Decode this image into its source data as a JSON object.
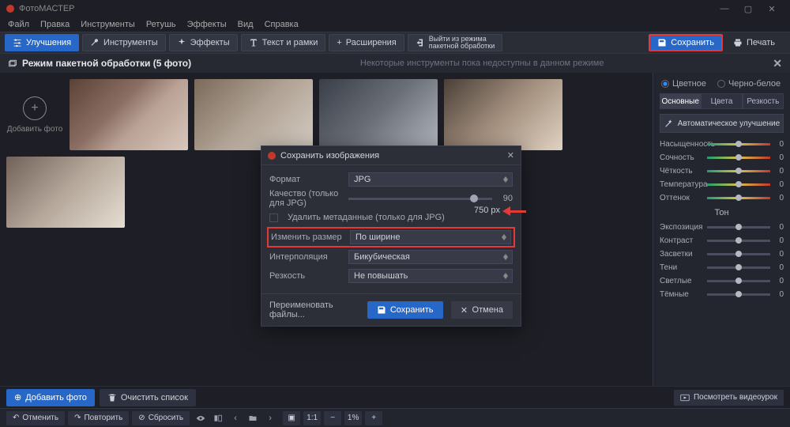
{
  "titlebar": {
    "app_name": "ФотоМАСТЕР"
  },
  "menubar": [
    "Файл",
    "Правка",
    "Инструменты",
    "Ретушь",
    "Эффекты",
    "Вид",
    "Справка"
  ],
  "toolbar": {
    "enhance": "Улучшения",
    "tools": "Инструменты",
    "effects": "Эффекты",
    "text": "Текст и рамки",
    "extensions": "Расширения",
    "exit_batch_l1": "Выйти из режима",
    "exit_batch_l2": "пакетной обработки",
    "save": "Сохранить",
    "print": "Печать"
  },
  "batch_header": {
    "title": "Режим пакетной обработки (5 фото)",
    "note": "Некоторые инструменты пока недоступны в данном режиме"
  },
  "stage": {
    "add_photo": "Добавить фото",
    "add_photo_btn": "Добавить фото",
    "clear_list": "Очистить список",
    "video_tutorial": "Посмотреть видеоурок"
  },
  "dialog": {
    "title": "Сохранить изображения",
    "format": {
      "label": "Формат",
      "value": "JPG"
    },
    "quality": {
      "label": "Качество (только для JPG)",
      "value": "90"
    },
    "meta": {
      "label": "Удалить метаданные (только для JPG)"
    },
    "resize": {
      "label": "Изменить размер",
      "value": "По ширине",
      "px_value": "750",
      "px_suffix": "px"
    },
    "interp": {
      "label": "Интерполяция",
      "value": "Бикубическая"
    },
    "sharp": {
      "label": "Резкость",
      "value": "Не повышать"
    },
    "rename": "Переименовать файлы...",
    "save": "Сохранить",
    "cancel": "Отмена"
  },
  "rpanel": {
    "mode_color": "Цветное",
    "mode_bw": "Черно-белое",
    "tabs": {
      "main": "Основные",
      "color": "Цвета",
      "sharp": "Резкость"
    },
    "auto": "Автоматическое улучшение",
    "sliders1": [
      {
        "label": "Насыщенность",
        "value": "0"
      },
      {
        "label": "Сочность",
        "value": "0"
      },
      {
        "label": "Чёткость",
        "value": "0"
      },
      {
        "label": "Температура",
        "value": "0"
      },
      {
        "label": "Оттенок",
        "value": "0"
      }
    ],
    "tone_header": "Тон",
    "sliders2": [
      {
        "label": "Экспозиция",
        "value": "0"
      },
      {
        "label": "Контраст",
        "value": "0"
      },
      {
        "label": "Засветки",
        "value": "0"
      },
      {
        "label": "Тени",
        "value": "0"
      },
      {
        "label": "Светлые",
        "value": "0"
      },
      {
        "label": "Тёмные",
        "value": "0"
      }
    ]
  },
  "bottombar": {
    "undo": "Отменить",
    "redo": "Повторить",
    "reset": "Сбросить",
    "ratio": "1:1",
    "zoom": "1%"
  }
}
